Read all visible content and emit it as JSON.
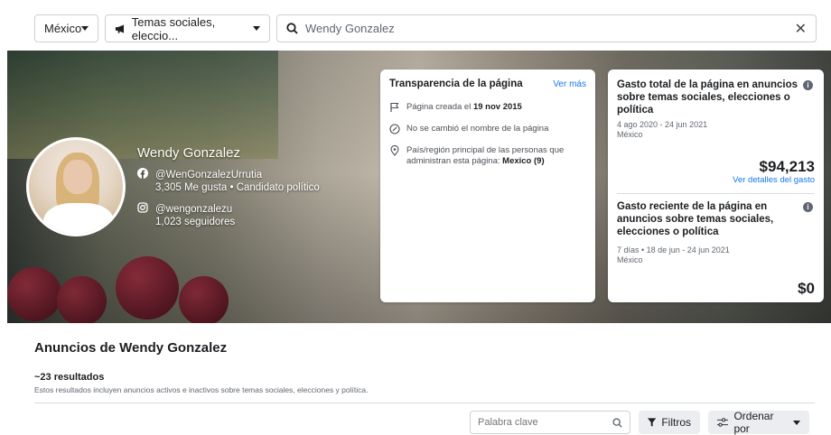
{
  "filters": {
    "country": "México",
    "category": "Temas sociales, eleccio...",
    "search_value": "Wendy Gonzalez"
  },
  "profile": {
    "name": "Wendy Gonzalez",
    "facebook_handle": "@WenGonzalezUrrutia",
    "facebook_stats": "3,305 Me gusta • Candidato político",
    "instagram_handle": "@wengonzalezu",
    "instagram_stats": "1,023 seguidores"
  },
  "transparency": {
    "title": "Transparencia de la página",
    "see_more": "Ver más",
    "created_prefix": "Página creada el",
    "created_date": "19 nov 2015",
    "name_change": "No se cambió el nombre de la página",
    "country_prefix": "País/región principal de las personas que administran esta página:",
    "country_value": "Mexico (9)"
  },
  "spend_total": {
    "title": "Gasto total de la página en anuncios sobre temas sociales, elecciones o política",
    "range": "4 ago 2020 - 24 jun 2021",
    "country": "México",
    "amount": "$94,213",
    "details_link": "Ver detalles del gasto"
  },
  "spend_recent": {
    "title": "Gasto reciente de la página en anuncios sobre temas sociales, elecciones o política",
    "range": "7 días • 18 de jun - 24 jun 2021",
    "country": "México",
    "amount": "$0"
  },
  "ads": {
    "title": "Anuncios de Wendy Gonzalez",
    "results_count": "~23 resultados",
    "results_note": "Estos resultados incluyen anuncios activos e inactivos sobre temas sociales, elecciones y política.",
    "keyword_placeholder": "Palabra clave",
    "filters_label": "Filtros",
    "sort_label": "Ordenar por"
  },
  "colors": {
    "link": "#1877f2",
    "border": "#ccd0d5",
    "button_bg": "#ebedf0"
  }
}
